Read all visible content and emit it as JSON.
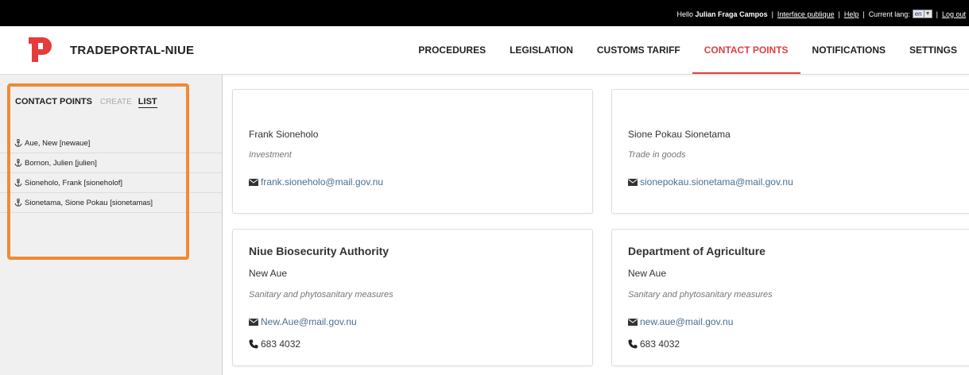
{
  "topbar": {
    "hello": "Hello",
    "user_name": "Julian Fraga Campos",
    "interface_link": "Interface publique",
    "help_link": "Help",
    "lang_label": "Current lang:",
    "lang_value": "en",
    "logout_link": "Log out",
    "separator": "|"
  },
  "header": {
    "brand": "TRADEPORTAL-NIUE",
    "logo_color": "#e63b3b",
    "nav": [
      {
        "label": "PROCEDURES"
      },
      {
        "label": "LEGISLATION"
      },
      {
        "label": "CUSTOMS TARIFF"
      },
      {
        "label": "CONTACT POINTS"
      },
      {
        "label": "NOTIFICATIONS"
      },
      {
        "label": "SETTINGS"
      }
    ],
    "active_color": "#e04040"
  },
  "sidebar": {
    "title": "CONTACT POINTS",
    "create": "CREATE",
    "list": "LIST",
    "items": [
      {
        "label": "Aue, New [newaue]"
      },
      {
        "label": "Bornon, Julien [julien]"
      },
      {
        "label": "Sioneholo, Frank [sioneholof]"
      },
      {
        "label": "Sionetama, Sione Pokau [sionetamas]"
      }
    ],
    "highlight_color": "#f08a34"
  },
  "cards": [
    {
      "name": "Frank Sioneholo",
      "dept": "Investment",
      "email": "frank.sioneholo@mail.gov.nu"
    },
    {
      "name": "Sione Pokau Sionetama",
      "dept": "Trade in goods",
      "email": "sionepokau.sionetama@mail.gov.nu"
    },
    {
      "org": "Niue Biosecurity Authority",
      "name": "New Aue",
      "dept": "Sanitary and phytosanitary measures",
      "email": "New.Aue@mail.gov.nu",
      "phone": "683 4032"
    },
    {
      "org": "Department of Agriculture",
      "name": "New Aue",
      "dept": "Sanitary and phytosanitary measures",
      "email": "new.aue@mail.gov.nu",
      "phone": "683 4032"
    }
  ]
}
